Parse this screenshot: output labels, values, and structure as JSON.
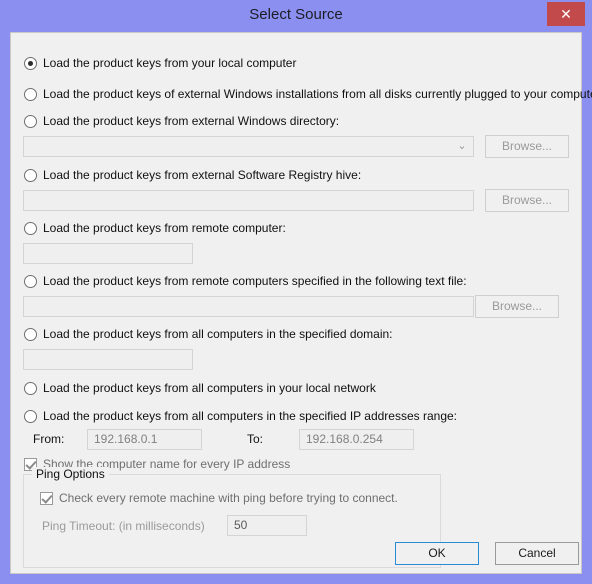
{
  "window": {
    "title": "Select Source",
    "close_icon": "close-icon",
    "close_glyph": "✕",
    "titlebar_color": "#8b8ff0",
    "close_button_color": "#c24a4a",
    "client_background": "#f0f0f0"
  },
  "options": [
    {
      "id": "local-computer",
      "label": "Load the product keys from your local computer",
      "selected": true
    },
    {
      "id": "external-windows-disks",
      "label": "Load the product keys of external Windows installations from all disks currently plugged to your computer",
      "selected": false
    },
    {
      "id": "external-windows-dir",
      "label": "Load the product keys from external Windows directory:",
      "selected": false
    },
    {
      "id": "external-registry-hive",
      "label": "Load the product keys from external Software Registry hive:",
      "selected": false
    },
    {
      "id": "remote-computer",
      "label": "Load the product keys from remote computer:",
      "selected": false
    },
    {
      "id": "remote-computers-file",
      "label": "Load the product keys from remote computers specified in the following text file:",
      "selected": false
    },
    {
      "id": "specified-domain",
      "label": "Load the product keys from all computers in the specified domain:",
      "selected": false
    },
    {
      "id": "local-network",
      "label": "Load the product keys from all computers in your local network",
      "selected": false
    },
    {
      "id": "ip-range",
      "label": "Load the product keys from all computers in the specified IP addresses range:",
      "selected": false
    }
  ],
  "fields": {
    "windows_directory": {
      "value": "",
      "placeholder": ""
    },
    "registry_hive": {
      "value": "",
      "placeholder": ""
    },
    "remote_computer": {
      "value": "",
      "placeholder": ""
    },
    "remote_text_file": {
      "value": "",
      "placeholder": ""
    },
    "domain": {
      "value": "",
      "placeholder": ""
    },
    "ip_from": {
      "value": "192.168.0.1",
      "placeholder": ""
    },
    "ip_to": {
      "value": "192.168.0.254",
      "placeholder": ""
    },
    "ping_timeout": {
      "value": "50",
      "placeholder": ""
    }
  },
  "browse_buttons": {
    "windows_directory": "Browse...",
    "registry_hive": "Browse...",
    "remote_text_file": "Browse..."
  },
  "combo": {
    "arrow_icon": "chevron-down-icon",
    "arrow_glyph": "⌄"
  },
  "ip_labels": {
    "from": "From:",
    "to": "To:"
  },
  "show_computer_name": {
    "label": "Show the computer name for every IP address",
    "checked": true
  },
  "ping_options": {
    "group_title": "Ping Options",
    "check_with_ping": {
      "label": "Check every remote machine with ping before trying to connect.",
      "checked": true
    },
    "timeout_label": "Ping Timeout: (in milliseconds)"
  },
  "buttons": {
    "ok": "OK",
    "cancel": "Cancel"
  }
}
